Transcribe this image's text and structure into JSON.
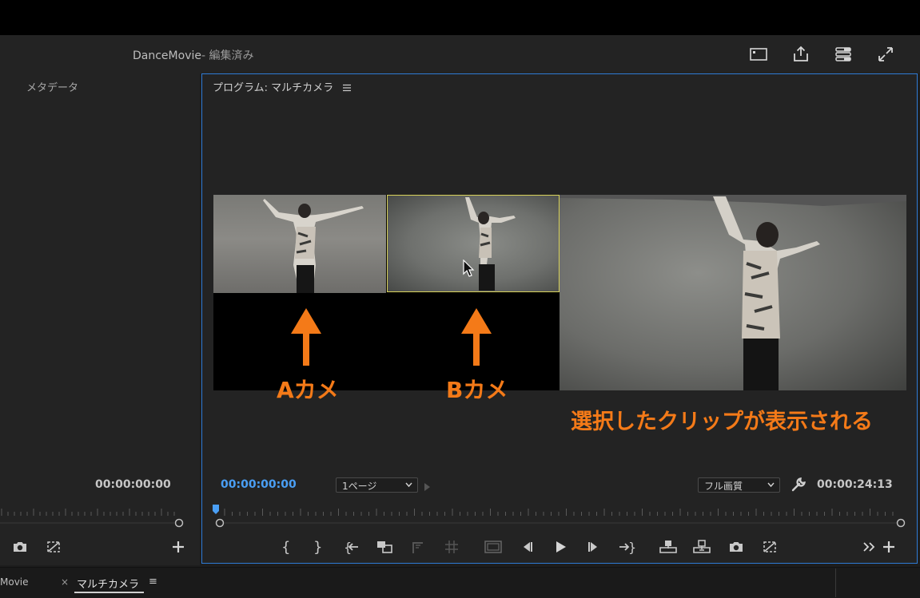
{
  "header": {
    "title": "DanceMovie",
    "title_suffix": "- 編集済み",
    "icons": [
      "panel-icon",
      "share-icon",
      "workspace-icon",
      "fullscreen-icon"
    ]
  },
  "left_panel": {
    "label": "メタデータ",
    "timecode": "00:00:00:00"
  },
  "program": {
    "title": "プログラム: マルチカメラ",
    "current_timecode": "00:00:00:00",
    "page_select": "1ページ",
    "quality_select": "フル画質",
    "duration_timecode": "00:00:24:13",
    "playhead_fraction": 0.0
  },
  "annotations": {
    "camera_a": "Aカメ",
    "camera_b": "Bカメ",
    "caption": "選択したクリップが表示される"
  },
  "bottom_tabs": {
    "tab1": "Movie",
    "tab2_close": "×",
    "tab2": "マルチカメラ",
    "tab2_menu": "≡"
  },
  "colors": {
    "accent_blue": "#2e7bd6",
    "timecode_blue": "#4a9ff5",
    "annotation_orange": "#f47a18",
    "selected_clip_border": "#d8d25a"
  }
}
